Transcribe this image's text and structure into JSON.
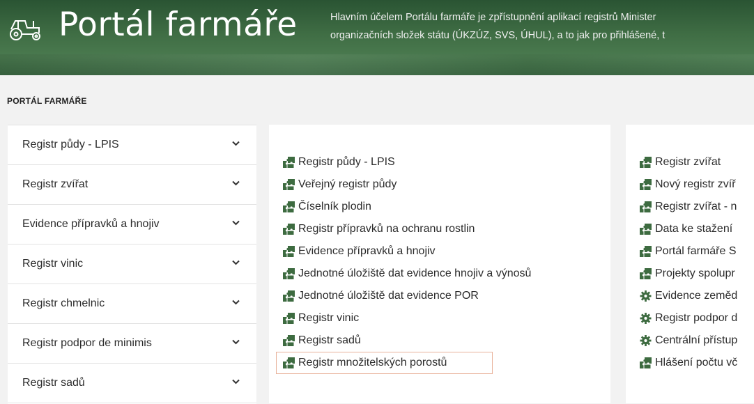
{
  "header": {
    "title": "Portál farmáře",
    "description_line1": "Hlavním účelem Portálu farmáře je zpřístupnění aplikací registrů Minister",
    "description_line2": "organizačních složek státu (ÚKZÚZ, SVS, ÚHUL), a to jak pro přihlášené, t",
    "logo_icon": "tractor-icon"
  },
  "breadcrumb": "PORTÁL FARMÁŘE",
  "sidebar": {
    "items": [
      {
        "label": "Registr půdy - LPIS"
      },
      {
        "label": "Registr zvířat"
      },
      {
        "label": "Evidence přípravků a hnojiv"
      },
      {
        "label": "Registr vinic"
      },
      {
        "label": "Registr chmelnic"
      },
      {
        "label": "Registr podpor de minimis"
      },
      {
        "label": "Registr sadů"
      }
    ],
    "chevron_icon": "chevron-down-icon"
  },
  "middle_links": [
    {
      "label": "Registr půdy - LPIS",
      "icon": "puzzle-icon"
    },
    {
      "label": "Veřejný registr půdy",
      "icon": "puzzle-icon"
    },
    {
      "label": "Číselník plodin",
      "icon": "puzzle-icon"
    },
    {
      "label": "Registr přípravků na ochranu rostlin",
      "icon": "puzzle-icon"
    },
    {
      "label": "Evidence přípravků a hnojiv",
      "icon": "puzzle-icon"
    },
    {
      "label": "Jednotné úložiště dat evidence hnojiv a výnosů",
      "icon": "puzzle-icon"
    },
    {
      "label": "Jednotné úložiště dat evidence POR",
      "icon": "puzzle-icon"
    },
    {
      "label": "Registr vinic",
      "icon": "puzzle-icon"
    },
    {
      "label": "Registr sadů",
      "icon": "puzzle-icon"
    },
    {
      "label": "Registr množitelských porostů",
      "icon": "puzzle-icon"
    }
  ],
  "right_links": [
    {
      "label": "Registr zvířat",
      "icon": "puzzle-icon"
    },
    {
      "label": "Nový registr zvíř",
      "icon": "puzzle-icon"
    },
    {
      "label": "Registr zvířat - n",
      "icon": "puzzle-icon"
    },
    {
      "label": "Data ke stažení",
      "icon": "puzzle-icon"
    },
    {
      "label": "Portál farmáře S",
      "icon": "puzzle-icon"
    },
    {
      "label": "Projekty spolupr",
      "icon": "puzzle-icon"
    },
    {
      "label": "Evidence zeměd",
      "icon": "gear-icon"
    },
    {
      "label": "Registr podpor d",
      "icon": "gear-icon"
    },
    {
      "label": "Centrální přístup",
      "icon": "gear-icon"
    },
    {
      "label": "Hlášení počtu vč",
      "icon": "puzzle-icon"
    }
  ],
  "colors": {
    "header_green": "#3f6d44",
    "icon_green": "#3d6b40",
    "highlight_border": "#e8b199"
  }
}
